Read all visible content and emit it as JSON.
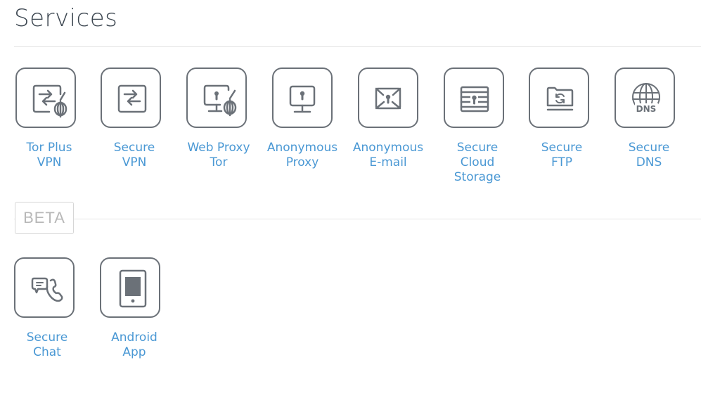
{
  "page": {
    "title": "Services",
    "beta_label": "BETA"
  },
  "services": [
    {
      "id": "tor-plus-vpn",
      "icon": "tor-vpn-icon",
      "line1": "Tor Plus",
      "line2": "VPN",
      "line3": ""
    },
    {
      "id": "secure-vpn",
      "icon": "vpn-arrows-icon",
      "line1": "Secure",
      "line2": "VPN",
      "line3": ""
    },
    {
      "id": "web-proxy-tor",
      "icon": "monitor-onion-icon",
      "line1": "Web Proxy",
      "line2": "Tor",
      "line3": ""
    },
    {
      "id": "anonymous-proxy",
      "icon": "monitor-lock-icon",
      "line1": "Anonymous",
      "line2": "Proxy",
      "line3": ""
    },
    {
      "id": "anonymous-email",
      "icon": "envelope-lock-icon",
      "line1": "Anonymous",
      "line2": "E-mail",
      "line3": ""
    },
    {
      "id": "secure-cloud-storage",
      "icon": "storage-lock-icon",
      "line1": "Secure",
      "line2": "Cloud",
      "line3": "Storage"
    },
    {
      "id": "secure-ftp",
      "icon": "folder-sync-icon",
      "line1": "Secure",
      "line2": "FTP",
      "line3": ""
    },
    {
      "id": "secure-dns",
      "icon": "globe-dns-icon",
      "line1": "Secure",
      "line2": "DNS",
      "line3": "",
      "icon_text": "DNS"
    }
  ],
  "beta_services": [
    {
      "id": "secure-chat",
      "icon": "chat-phone-icon",
      "line1": "Secure",
      "line2": "Chat"
    },
    {
      "id": "android-app",
      "icon": "phone-device-icon",
      "line1": "Android",
      "line2": "App"
    }
  ],
  "colors": {
    "icon": "#6b7178",
    "label": "#4a98d4",
    "title": "#3c4650",
    "rule": "#e5e5e5",
    "beta": "#b8b8b8"
  }
}
